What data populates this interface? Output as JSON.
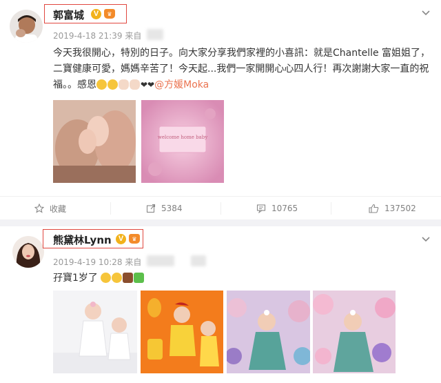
{
  "posts": [
    {
      "username": "郭富城",
      "v_badge": "V",
      "timestamp": "2019-4-18 21:39",
      "source_prefix": "来自",
      "text_body": "今天我很開心，特別的日子。向大家分享我們家裡的小喜訊：就是Chantelle 富姐姐了，二寶健康可愛，媽媽辛苦了！今天起...我們一家開開心心四人行！再次謝謝大家一直的祝福。。感恩",
      "mention": "@方媛Moka",
      "images": [
        {
          "name": "baby-feet-in-hands-photo"
        },
        {
          "name": "welcome-baby-card-photo",
          "caption": "welcome home baby"
        }
      ],
      "actions": {
        "favorite_label": "收藏",
        "repost_count": "5384",
        "comment_count": "10765",
        "like_count": "137502"
      }
    },
    {
      "username": "熊黛林Lynn",
      "v_badge": "V",
      "timestamp": "2019-4-19 10:28",
      "source_prefix": "来自",
      "text_body": "孖寶1岁了",
      "images": [
        {
          "name": "twins-white-dresses-photo"
        },
        {
          "name": "twins-orange-backdrop-photo"
        },
        {
          "name": "baby-purple-balloons-photo"
        },
        {
          "name": "baby-pink-balloons-photo"
        }
      ]
    }
  ],
  "colors": {
    "highlight_box": "#e0463e",
    "mention": "#eb7350",
    "verified": "#f2b21b",
    "meta_text": "#999999"
  },
  "icons": {
    "favorite": "star-icon",
    "repost": "repost-icon",
    "comment": "comment-icon",
    "like": "thumbs-up-icon",
    "more": "chevron-down-icon"
  }
}
